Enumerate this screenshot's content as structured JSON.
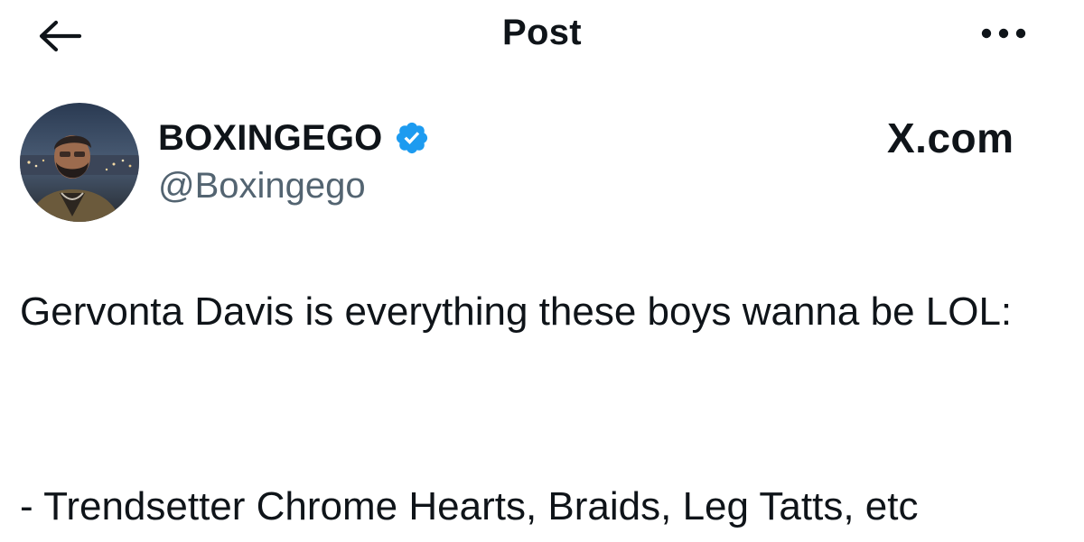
{
  "header": {
    "title": "Post",
    "back_icon": "arrow-left-icon",
    "more_icon": "ellipsis-icon"
  },
  "author": {
    "display_name": "BOXINGEGO",
    "handle": "@Boxingego",
    "verified": true,
    "verified_color": "#1d9bf0"
  },
  "watermark": "X.com",
  "tweet": {
    "text_line1": "Gervonta Davis is everything these boys wanna be LOL:",
    "text_line2": "- Trendsetter Chrome Hearts, Braids, Leg Tatts, etc"
  },
  "colors": {
    "text": "#0f1419",
    "secondary": "#536471",
    "background": "#ffffff"
  }
}
